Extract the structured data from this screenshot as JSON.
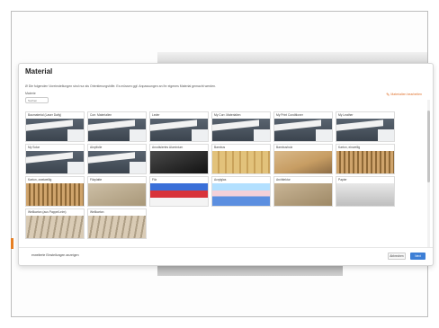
{
  "modal": {
    "title": "Material",
    "description": "Ø Die folgenden Voreinstellungen sind nur als Orientierungshilfe. Es müssen ggf. Anpassungen an Ihr eigenes Material gemacht werden.",
    "section_label": "Materie",
    "search_placeholder": "Suchen",
    "edit_link": "Materialien bearbeiten"
  },
  "materials": [
    {
      "label": "Baumaterial (Laser Daily)",
      "texture": "dark"
    },
    {
      "label": "Corr. Materialien",
      "texture": "dark"
    },
    {
      "label": "Leder",
      "texture": "dark"
    },
    {
      "label": "My Corr. Materialien",
      "texture": "dark"
    },
    {
      "label": "My Print Conditioner",
      "texture": "dark"
    },
    {
      "label": "My Leather",
      "texture": "dark"
    },
    {
      "label": "My Solar",
      "texture": "dark"
    },
    {
      "label": "Akrylfolie",
      "texture": "dark"
    },
    {
      "label": "Anodisiertes Aluminium",
      "texture": "black"
    },
    {
      "label": "Bambus",
      "texture": "bamboo"
    },
    {
      "label": "Bambusholz",
      "texture": "wood"
    },
    {
      "label": "Karton, einwellig",
      "texture": "corrugated"
    },
    {
      "label": "Karton, zweiwellig",
      "texture": "corrugated"
    },
    {
      "label": "Filzplatte",
      "texture": "felt"
    },
    {
      "label": "Filz",
      "texture": "acryl"
    },
    {
      "label": "Acrylglas",
      "texture": "acryl2"
    },
    {
      "label": "Architektur",
      "texture": "mdf"
    },
    {
      "label": "Papier",
      "texture": "paper"
    },
    {
      "label": "Wellkarton (aus Pappe/Leim)",
      "texture": "cardboard"
    },
    {
      "label": "Wellkarton",
      "texture": "cardboard"
    }
  ],
  "footer": {
    "advanced_link": "erweiterte Einstellungen anzeigen",
    "cancel_label": "Abbrechen",
    "next_label": "Next"
  },
  "colors": {
    "accent": "#e0712b",
    "primary_button": "#3d7fd6"
  },
  "icons": {
    "edit": "edit-icon"
  }
}
